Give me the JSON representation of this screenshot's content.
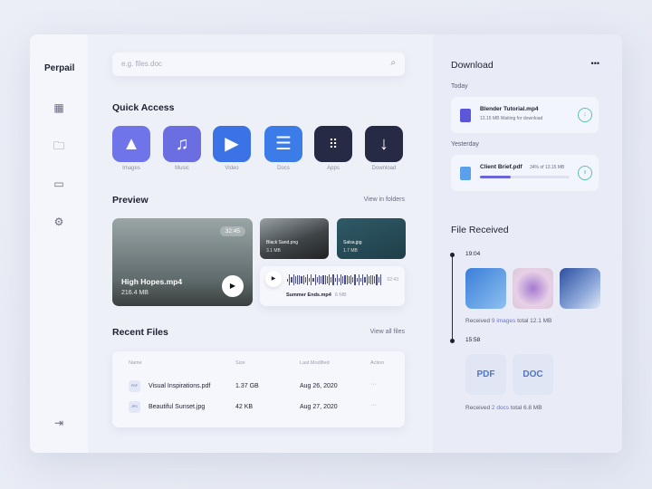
{
  "app": {
    "logo": "Perpail"
  },
  "sidebar": {
    "icons": [
      "grid-icon",
      "folder-icon",
      "devices-icon",
      "gear-icon",
      "logout-icon"
    ]
  },
  "search": {
    "placeholder": "e.g. files.doc"
  },
  "quick_access": {
    "title": "Quick Access",
    "items": [
      {
        "label": "Images",
        "icon": "image-icon",
        "color": "#6f74e8"
      },
      {
        "label": "Music",
        "icon": "music-icon",
        "color": "#6a6ee0"
      },
      {
        "label": "Video",
        "icon": "play-icon",
        "color": "#3b73e6"
      },
      {
        "label": "Docs",
        "icon": "list-icon",
        "color": "#3b7ce8"
      },
      {
        "label": "Apps",
        "icon": "apps-icon",
        "color": "#262a45"
      },
      {
        "label": "Download",
        "icon": "download-icon",
        "color": "#262a45"
      }
    ]
  },
  "preview": {
    "title": "Preview",
    "link": "View in folders",
    "video": {
      "name": "High Hopes.mp4",
      "size": "216.4 MB",
      "duration": "32:45"
    },
    "thumbs": [
      {
        "name": "Black Sand.png",
        "size": "3.1 MB"
      },
      {
        "name": "Salsa.jpg",
        "size": "1.7 MB"
      }
    ],
    "audio": {
      "name": "Summer Ends.mp4",
      "size": "6 MB",
      "duration": "02:43"
    }
  },
  "recent": {
    "title": "Recent Files",
    "link": "View all files",
    "headers": [
      "Name",
      "Size",
      "Last Modified",
      "Action"
    ],
    "rows": [
      {
        "type": "PDF",
        "name": "Visual Inspirations.pdf",
        "size": "1.37 GB",
        "modified": "Aug 26, 2020",
        "action": "···"
      },
      {
        "type": "JPG",
        "name": "Beautiful Sunset.jpg",
        "size": "42 KB",
        "modified": "Aug 27, 2020",
        "action": "···"
      }
    ]
  },
  "download": {
    "title": "Download",
    "more": "•••",
    "today": "Today",
    "yesterday": "Yesterday",
    "items": [
      {
        "name": "Blender Tutorial.mp4",
        "meta": "13.15 MB   Waiting for download",
        "action": "↓"
      },
      {
        "name": "Client Brief.pdf",
        "meta": "34% of  13.15 MB",
        "progress": 34,
        "action": "II"
      }
    ]
  },
  "received": {
    "title": "File Received",
    "groups": [
      {
        "time": "19:04",
        "pre": "Received ",
        "count": "9 images",
        "post": " total 12.1 MB"
      },
      {
        "time": "15:58",
        "pre": "Received ",
        "count": "2 docs",
        "post": " total 6.8 MB",
        "docs": [
          "PDF",
          "DOC"
        ]
      }
    ]
  }
}
